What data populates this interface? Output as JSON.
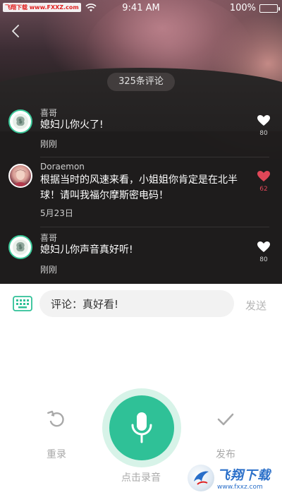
{
  "status_bar": {
    "carrier": "飞翔下载 www.FXXZ.com",
    "time": "9:41 AM",
    "battery": "100%"
  },
  "header": {
    "comment_count": "325条评论"
  },
  "comments": [
    {
      "name": "喜哥",
      "text": "媳妇儿你火了!",
      "time": "刚刚",
      "likes": "80",
      "liked": false,
      "avatar": "rose-avatar"
    },
    {
      "name": "Doraemon",
      "text": "根据当时的风速来看，小姐姐你肯定是在北半球！请叫我福尔摩斯密电码！",
      "time": "5月23日",
      "likes": "62",
      "liked": true,
      "avatar": "girl-avatar"
    },
    {
      "name": "喜哥",
      "text": "媳妇儿你声音真好听!",
      "time": "刚刚",
      "likes": "80",
      "liked": false,
      "avatar": "rose-avatar"
    }
  ],
  "input": {
    "value": "评论：真好看!",
    "send_label": "发送"
  },
  "recorder": {
    "rerecord_label": "重录",
    "record_label": "点击录音",
    "publish_label": "发布"
  },
  "watermark": {
    "name": "飞翔下载",
    "url": "www.fxxz.com"
  },
  "colors": {
    "accent": "#2fc197",
    "accent_ring": "#d7f3e8",
    "like_active": "#e04758",
    "muted": "#a9a9a9"
  }
}
